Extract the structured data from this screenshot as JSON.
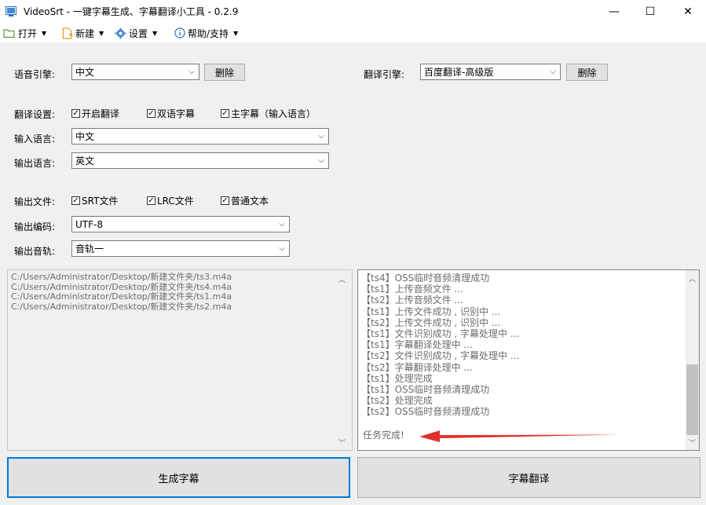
{
  "window": {
    "title": "VideoSrt - 一键字幕生成、字幕翻译小工具 - 0.2.9",
    "minimize": "—",
    "maximize": "☐",
    "close": "✕"
  },
  "menu": {
    "open": "打开",
    "new": "新建",
    "settings": "设置",
    "help": "帮助/支持"
  },
  "form": {
    "speech_engine_label": "语音引擎:",
    "speech_engine_value": "中文",
    "delete_label": "删除",
    "translate_engine_label": "翻译引擎:",
    "translate_engine_value": "百度翻译-高级版",
    "translate_settings_label": "翻译设置:",
    "translate_checks": [
      {
        "label": "开启翻译",
        "checked": true
      },
      {
        "label": "双语字幕",
        "checked": true
      },
      {
        "label": "主字幕（输入语言）",
        "checked": true
      }
    ],
    "input_lang_label": "输入语言:",
    "input_lang_value": "中文",
    "output_lang_label": "输出语言:",
    "output_lang_value": "英文",
    "output_file_label": "输出文件:",
    "output_checks": [
      {
        "label": "SRT文件",
        "checked": true
      },
      {
        "label": "LRC文件",
        "checked": true
      },
      {
        "label": "普通文本",
        "checked": true
      }
    ],
    "encoding_label": "输出编码:",
    "encoding_value": "UTF-8",
    "track_label": "输出音轨:",
    "track_value": "音轨一"
  },
  "files": [
    "C:/Users/Administrator/Desktop/新建文件夹/ts3.m4a",
    "C:/Users/Administrator/Desktop/新建文件夹/ts4.m4a",
    "C:/Users/Administrator/Desktop/新建文件夹/ts1.m4a",
    "C:/Users/Administrator/Desktop/新建文件夹/ts2.m4a"
  ],
  "log": [
    "【ts4】OSS临时音频清理成功",
    "【ts1】上传音频文件 ...",
    "【ts2】上传音频文件 ...",
    "【ts1】上传文件成功 , 识别中 ...",
    "【ts2】上传文件成功 , 识别中 ...",
    "【ts1】文件识别成功 , 字幕处理中 ...",
    "【ts1】字幕翻译处理中 ...",
    "【ts2】文件识别成功 , 字幕处理中 ...",
    "【ts2】字幕翻译处理中 ...",
    "【ts1】处理完成",
    "【ts1】OSS临时音频清理成功",
    "【ts2】处理完成",
    "【ts2】OSS临时音频清理成功"
  ],
  "task_done": "任务完成!",
  "buttons": {
    "generate": "生成字幕",
    "translate": "字幕翻译"
  },
  "colors": {
    "accent": "#0078d7",
    "arrow": "#e0302a"
  }
}
